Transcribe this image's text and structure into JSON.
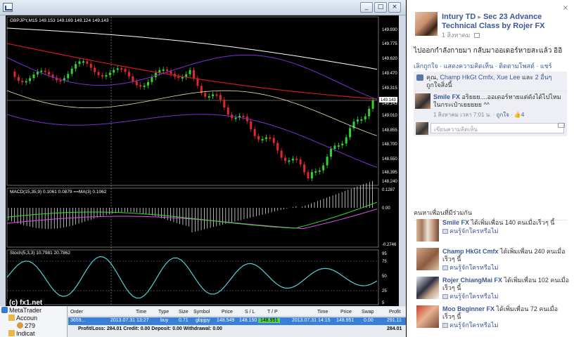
{
  "mt4": {
    "window_title": "",
    "chart_label": "GBPJPY,M15  149.153 149.169 149.124 149.143",
    "price_labels": [
      "149.930",
      "149.775",
      "149.620",
      "149.470",
      "149.315",
      "149.155",
      "149.143",
      "149.010",
      "148.855",
      "148.700",
      "148.550",
      "148.395",
      "148.240"
    ],
    "macd_label": "MACD(15,35,9) 0.1061 0.0879  ==MA(3) 0.1062",
    "macd_scale": [
      "0.1287",
      "0.00",
      "-0.2746"
    ],
    "stoch_label": "Stoch(5,3,3) 10.7981 20.7862",
    "stoch_scale": [
      "95",
      "75",
      "50",
      "25",
      "5"
    ],
    "watermark": "(c) fx1.net",
    "navigator": {
      "root": "MetaTrader",
      "accounts": "Accoun",
      "account_number": "279",
      "indicators": "Indicat"
    },
    "orders": {
      "headers": [
        "Order",
        "Time",
        "Type",
        "Size",
        "Symbol",
        "Price",
        "S / L",
        "T / P",
        "Time",
        "Price",
        "Swap",
        "Profit"
      ],
      "row": {
        "order": "3659...",
        "open_time": "2013.07.31 13:27",
        "type": "buy",
        "size": "0.71",
        "symbol": "gbpjpy",
        "price": "148.549",
        "sl": "148.150",
        "tp": "148.951",
        "close_time": "2013.07.31 14:15",
        "close_price": "148.951",
        "swap": "0.00",
        "profit": "291.11"
      },
      "summary": "Profit/Loss: 284.01  Credit: 0.00  Deposit: 0.00  Withdrawal: 0.00",
      "summary_total": "284.01"
    }
  },
  "facebook": {
    "close_glyph": "×",
    "poster": "Intury TD",
    "arrow": "▸",
    "group": "Sec 23 Advance Technical Class by Rojer FX",
    "date": "1 สิงหาคม",
    "post_text": "ไปออกกำลังกายมา กลับมาออเดอร์หายสะแล้ว อิอิ",
    "actions": "เลิกถูกใจ · แสดงความคิดเห็น · ติดตามโพสต์ · แชร์",
    "likes_prefix": "คุณ,",
    "likes_names": "Champ HkGt Cmfx, Xue Lee",
    "likes_mid": " และ ",
    "likes_more": "2 อื่นๆ",
    "likes_suffix": " ถูกใจสิ่งนี้",
    "comment_author": "Smile FX",
    "comment_text": "อริยยย....ออเดอร์หายแต่ดังได้ไปไหมในกระเป๋าเยยยยย ^^",
    "comment_time": "1 สิงหาคม เวลา 7:01 น.",
    "comment_like": "ถูกใจ",
    "comment_likes": "4",
    "reply_placeholder": "เขียนความคิดเห็น",
    "friends_title": "คนหาเพื่อนที่มีร่วมกัน",
    "friends": [
      {
        "name": "Smile FX",
        "text": " ได้เพิ่มเพื่อน 140 คนเมื่อเร็วๆ นี้",
        "add": "คนรู้จักใครหรือไม่"
      },
      {
        "name": "Champ HkGt Cmfx",
        "text": " ได้เพิ่มเพื่อน 240 คนเมื่อเร็วๆ นี้",
        "add": "คนรู้จักใครหรือไม่"
      },
      {
        "name": "Rojer ChiangMai FX",
        "text": " ได้เพิ่มเพื่อน 102 คนเมื่อเร็วๆ นี้",
        "add": "คนรู้จักใครหรือไม่"
      },
      {
        "name": "Moo Beginner FX",
        "text": " ได้เพิ่มเพื่อน 72 คนเมื่อเร็วๆ นี้",
        "add": "คนรู้จักใครหรือไม่"
      }
    ]
  },
  "colors": {
    "bull_candle": "#2ed52e",
    "bear_candle": "#e22828",
    "ma_fast": "#ffffff",
    "ma_slow": "#d11a1a",
    "bands": "#7b2fd6",
    "macd_hist": "#ffffff",
    "macd_ma": "#e04df0",
    "macd_signal": "#2ee02e",
    "stoch_main": "#54d0d8",
    "facebook_link": "#3b5998",
    "selected_row": "#3a7fd6",
    "tp_highlight": "#58d558"
  }
}
